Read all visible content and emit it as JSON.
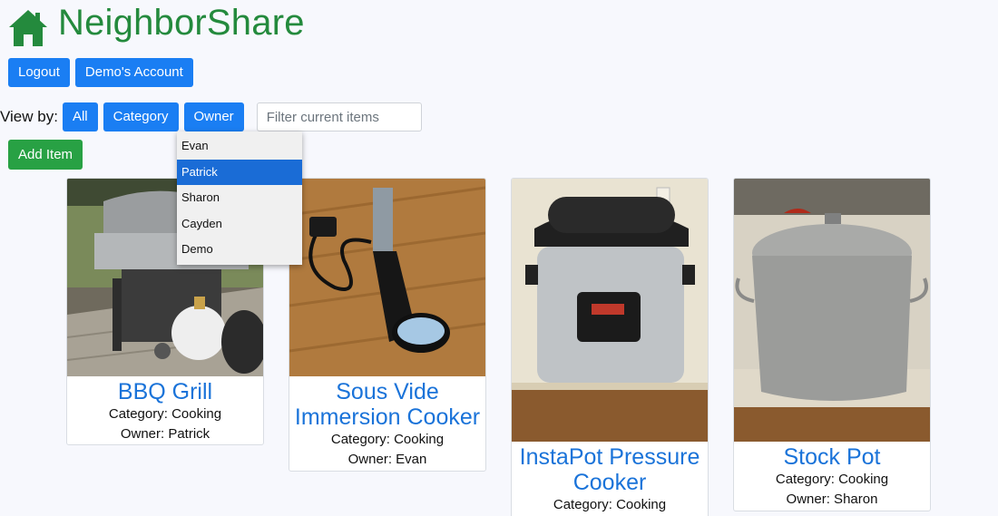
{
  "header": {
    "app_title": "NeighborShare",
    "icon": "home-icon"
  },
  "account": {
    "logout_label": "Logout",
    "account_label": "Demo's Account"
  },
  "view_by": {
    "label": "View by:",
    "buttons": [
      "All",
      "Category",
      "Owner"
    ],
    "filter_placeholder": "Filter current items"
  },
  "add_item_label": "Add Item",
  "owner_dropdown": {
    "options": [
      "Evan",
      "Patrick",
      "Sharon",
      "Cayden",
      "Demo"
    ],
    "selected": "Patrick"
  },
  "items": [
    {
      "title": "BBQ Grill",
      "category": "Category: Cooking",
      "owner": "Owner: Patrick"
    },
    {
      "title": "Sous Vide Immersion Cooker",
      "category": "Category: Cooking",
      "owner": "Owner: Evan"
    },
    {
      "title": "InstaPot Pressure Cooker",
      "category": "Category: Cooking",
      "owner": ""
    },
    {
      "title": "Stock Pot",
      "category": "Category: Cooking",
      "owner": "Owner: Sharon"
    }
  ],
  "colors": {
    "brand_green": "#248a3d",
    "button_blue": "#1a7ef3",
    "add_green": "#28a144",
    "title_blue": "#1a73d9"
  }
}
